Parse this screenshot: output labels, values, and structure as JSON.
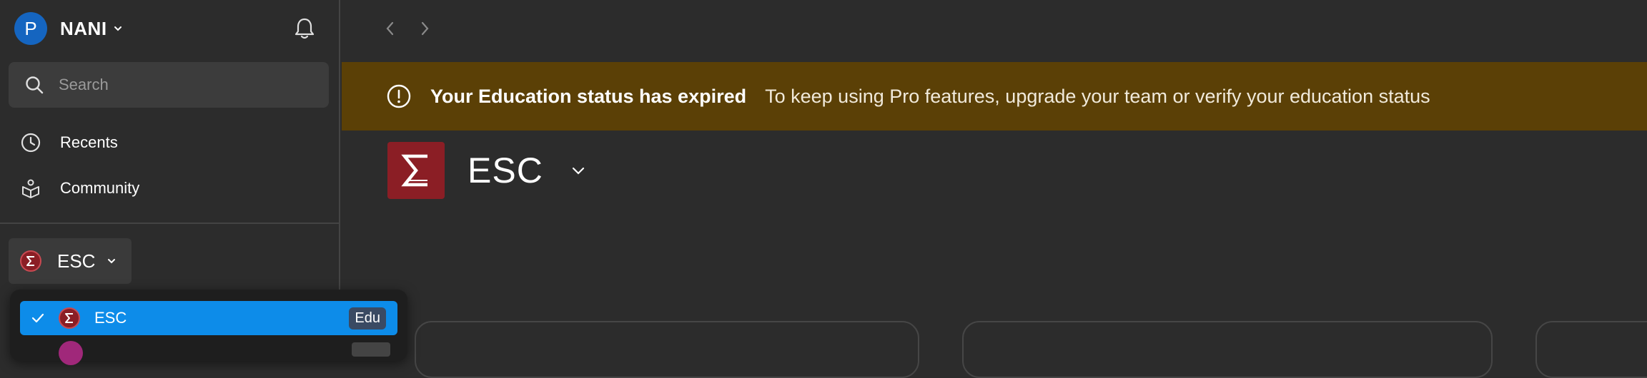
{
  "user": {
    "avatar_initial": "P",
    "name": "NANI"
  },
  "search": {
    "placeholder": "Search"
  },
  "nav": {
    "recents": "Recents",
    "community": "Community"
  },
  "team": {
    "name": "ESC"
  },
  "dropdown": {
    "items": [
      {
        "label": "ESC",
        "badge": "Edu",
        "selected": true
      }
    ]
  },
  "banner": {
    "title": "Your Education status has expired",
    "message": "To keep using Pro features, upgrade your team or verify your education status"
  },
  "header": {
    "title": "ESC"
  },
  "colors": {
    "background": "#2c2c2c",
    "banner": "#5b4006",
    "accent": "#0d8ce9",
    "team_logo": "#8b1e25",
    "avatar": "#1565c0"
  }
}
